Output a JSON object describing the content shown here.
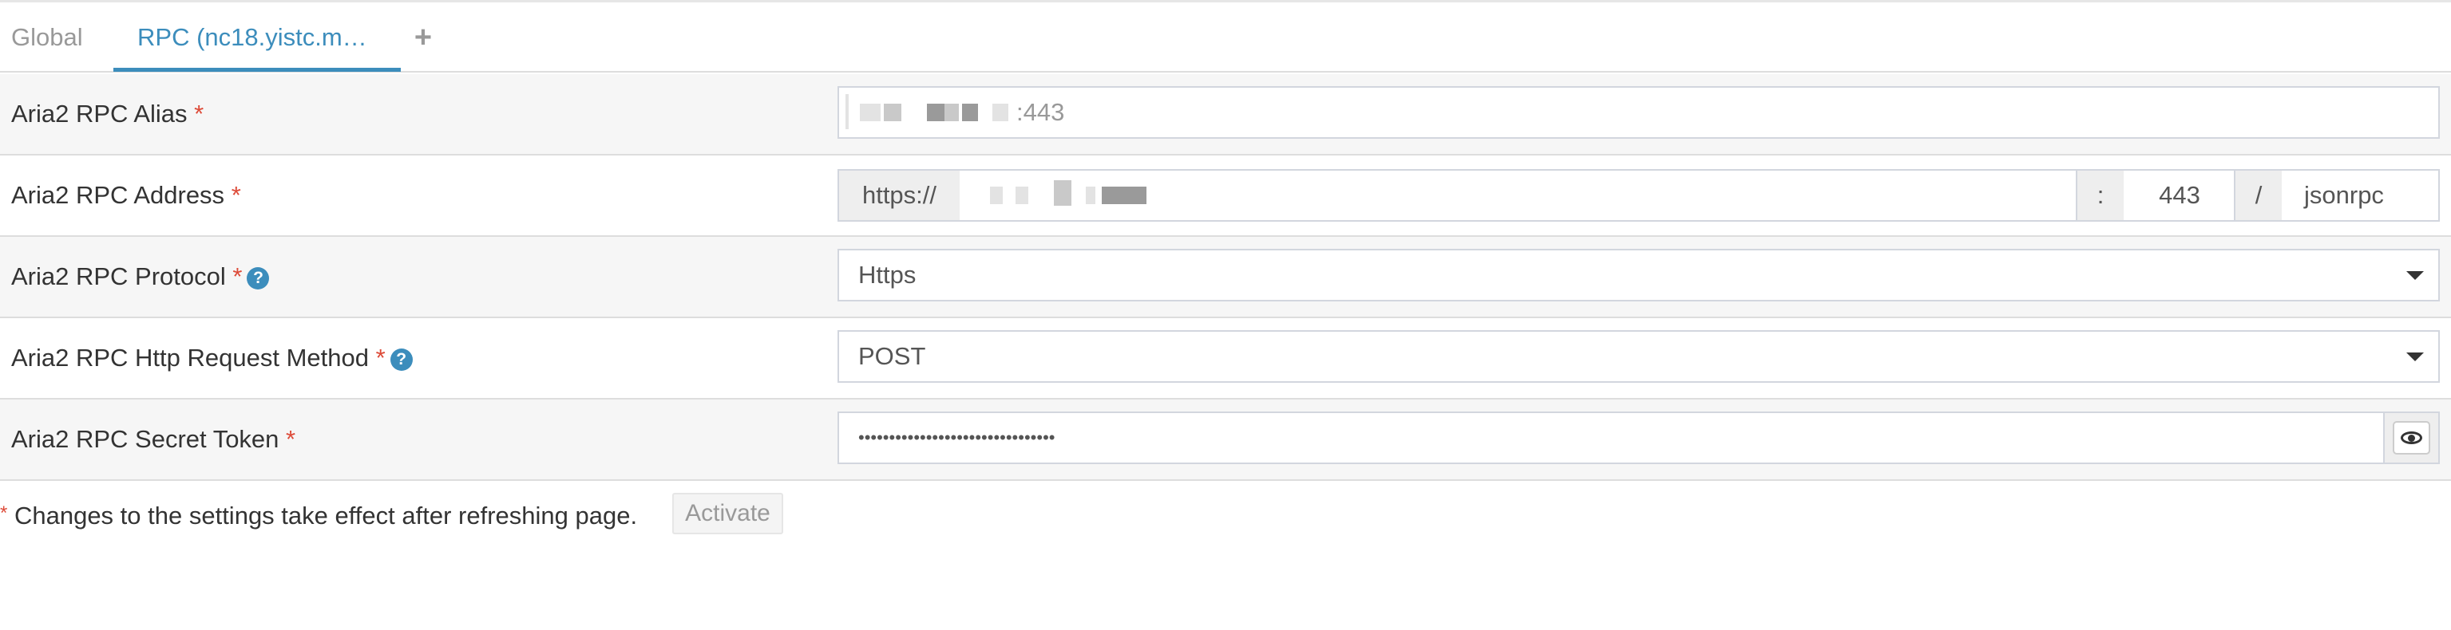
{
  "tabs": {
    "items": [
      {
        "label": "Global",
        "active": false
      },
      {
        "label": "RPC (nc18.yistc.m…",
        "active": true
      }
    ],
    "add_icon": "plus-icon"
  },
  "settings": {
    "alias": {
      "label": "Aria2 RPC Alias",
      "required": "*",
      "value_suffix": ":443"
    },
    "address": {
      "label": "Aria2 RPC Address",
      "required": "*",
      "protocol_prefix": "https://",
      "port_separator": ":",
      "port": "443",
      "path_separator": "/",
      "path": "jsonrpc"
    },
    "protocol": {
      "label": "Aria2 RPC Protocol",
      "required": "*",
      "help_icon": "question-circle-icon",
      "selected": "Https"
    },
    "request_method": {
      "label": "Aria2 RPC Http Request Method",
      "required": "*",
      "help_icon": "question-circle-icon",
      "selected": "POST"
    },
    "secret_token": {
      "label": "Aria2 RPC Secret Token",
      "required": "*",
      "masked_value": "••••••••••••••••••••••••••••••••",
      "toggle_icon": "eye-icon"
    }
  },
  "footer": {
    "asterisk": "*",
    "note": "Changes to the settings take effect after refreshing page.",
    "activate_label": "Activate"
  },
  "colors": {
    "accent": "#3c8dbc",
    "required": "#dd4b39",
    "row_shade": "#f6f6f6",
    "border": "#d2d6de"
  }
}
